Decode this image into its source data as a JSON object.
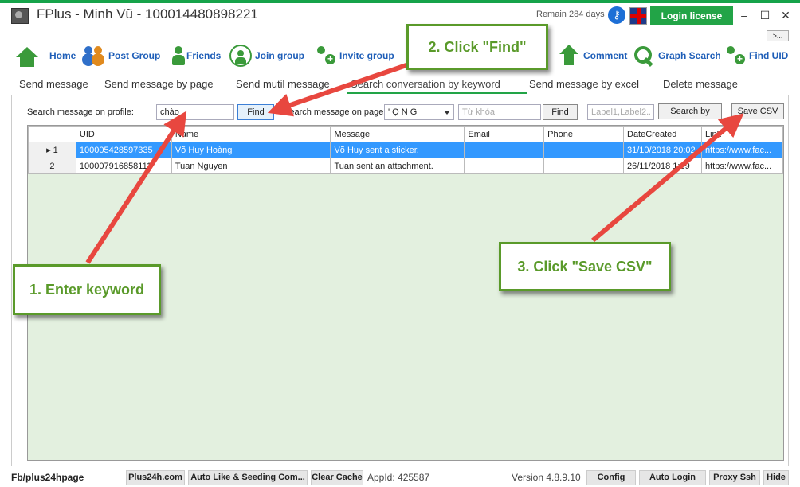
{
  "window": {
    "title": "FPlus - Minh Vũ - 100014480898221",
    "remain": "Remain 284 days",
    "login_license": "Login license",
    "minimize": "–",
    "maximize": "☐",
    "close": "✕",
    "more": ">..."
  },
  "toolbar": {
    "items": [
      {
        "label": "Home",
        "icon": "house-icon"
      },
      {
        "label": "Post Group",
        "icon": "people-icon"
      },
      {
        "label": "Friends",
        "icon": "person-icon"
      },
      {
        "label": "Join group",
        "icon": "group-icon"
      },
      {
        "label": "Invite group",
        "icon": "invite-icon"
      },
      {
        "label": "Comment",
        "icon": "arrow-up-icon"
      },
      {
        "label": "Graph Search",
        "icon": "search-icon"
      },
      {
        "label": "Find UID",
        "icon": "add-person-icon"
      }
    ]
  },
  "tabs": [
    "Send message",
    "Send message by page",
    "Send mutil message",
    "Search conversation by keyword",
    "Send message by excel",
    "Delete message"
  ],
  "search": {
    "profile_label": "Search message on profile:",
    "keyword_value": "chào",
    "find_label": "Find",
    "page_label": "Search message on page:",
    "page_selected": "' Ọ N G",
    "page_keyword_placeholder": "Từ khóa",
    "find2_label": "Find",
    "label_placeholder": "Label1,Label2...",
    "search_by_label": "Search by",
    "save_csv_label": "Save CSV"
  },
  "table": {
    "columns": [
      "UID",
      "Name",
      "Message",
      "Email",
      "Phone",
      "DateCreated",
      "Link"
    ],
    "rows": [
      {
        "num": "1",
        "uid": "100005428597335",
        "name": "Võ Huy Hoàng",
        "message": "Võ Huy sent a sticker.",
        "email": "",
        "phone": "",
        "date": "31/10/2018 20:02",
        "link": "https://www.fac..."
      },
      {
        "num": "2",
        "uid": "100007916858111",
        "name": "Tuan Nguyen",
        "message": "Tuan sent an attachment.",
        "email": "",
        "phone": "",
        "date": "26/11/2018 1:39",
        "link": "https://www.fac..."
      }
    ]
  },
  "statusbar": {
    "fb_link": "Fb/plus24hpage",
    "buttons": [
      "Plus24h.com",
      "Auto Like & Seeding Com...",
      "Clear Cache"
    ],
    "app_id": "AppId: 425587",
    "version": "Version 4.8.9.10",
    "right_buttons": [
      "Config",
      "Auto Login",
      "Proxy Ssh",
      "Hide"
    ]
  },
  "callouts": {
    "step1": "1. Enter keyword",
    "step2": "2. Click \"Find\"",
    "step3": "3. Click \"Save CSV\""
  },
  "colors": {
    "accent_green": "#22a447",
    "callout_green": "#5a9a2a",
    "arrow_red": "#e8473f",
    "selection_blue": "#3399ff"
  }
}
